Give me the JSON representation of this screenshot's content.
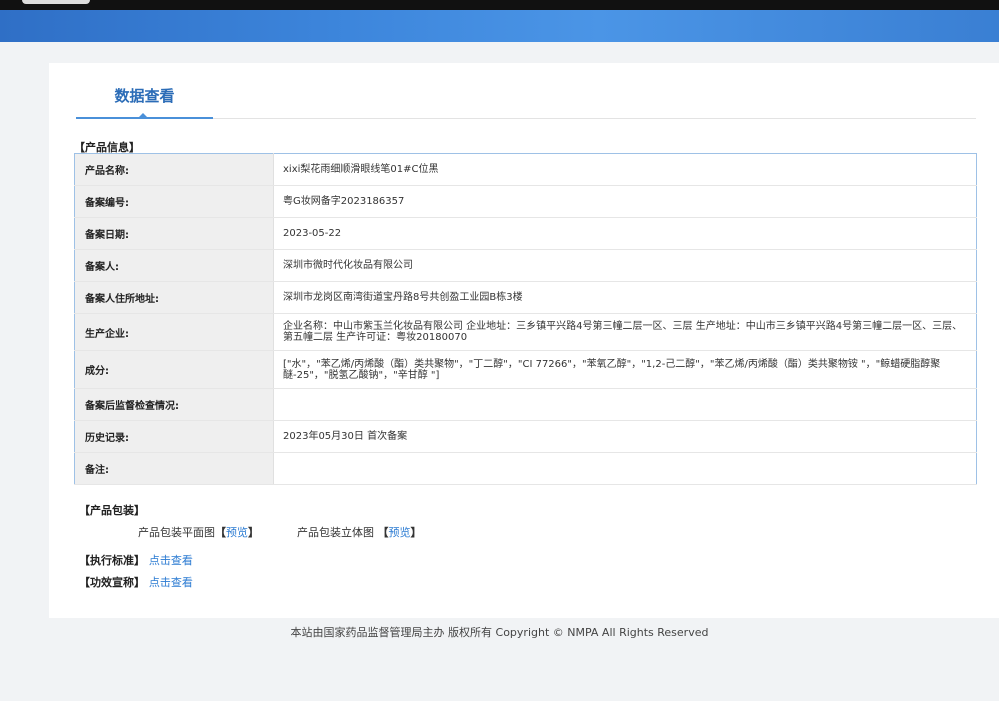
{
  "header": {
    "tab_title": "数据查看"
  },
  "product_info": {
    "section_title": "【产品信息】",
    "rows": [
      {
        "label": "产品名称:",
        "value": "xixi梨花雨细顺滑眼线笔01#C位黑"
      },
      {
        "label": "备案编号:",
        "value": "粤G妆网备字2023186357"
      },
      {
        "label": "备案日期:",
        "value": "2023-05-22"
      },
      {
        "label": "备案人:",
        "value": "深圳市微时代化妆品有限公司"
      },
      {
        "label": "备案人住所地址:",
        "value": "深圳市龙岗区南湾街道宝丹路8号共创盈工业园B栋3楼"
      },
      {
        "label": "生产企业:",
        "value": "企业名称：中山市紫玉兰化妆品有限公司 企业地址：三乡镇平兴路4号第三幢二层一区、三层 生产地址：中山市三乡镇平兴路4号第三幢二层一区、三层、第五幢二层 生产许可证：粤妆20180070"
      },
      {
        "label": "成分:",
        "value": "[\"水\"，\"苯乙烯/丙烯酸（酯）类共聚物\"，\"丁二醇\"，\"CI 77266\"，\"苯氧乙醇\"，\"1,2-己二醇\"，\"苯乙烯/丙烯酸（酯）类共聚物铵 \"，\"鲸蜡硬脂醇聚醚-25\"，\"脱氢乙酸钠\"，\"辛甘醇 \"]"
      },
      {
        "label": "备案后监督检查情况:",
        "value": ""
      },
      {
        "label": "历史记录:",
        "value": "2023年05月30日 首次备案"
      },
      {
        "label": "备注:",
        "value": ""
      }
    ]
  },
  "packaging": {
    "section_title": "【产品包装】",
    "flat_label": "产品包装平面图",
    "solid_label": "产品包装立体图",
    "bracket_open": "【",
    "bracket_close": "】",
    "preview": "预览"
  },
  "standards": {
    "label": "【执行标准】",
    "link": "点击查看"
  },
  "efficacy": {
    "label": "【功效宣称】",
    "link": "点击查看"
  },
  "footer": {
    "text": "本站由国家药品监督管理局主办 版权所有 Copyright © NMPA All Rights Reserved"
  }
}
